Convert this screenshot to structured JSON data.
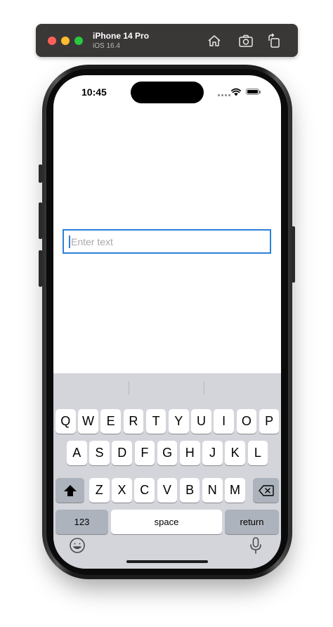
{
  "simulator": {
    "device_name": "iPhone 14 Pro",
    "os_version": "iOS 16.4",
    "icons": [
      "home-icon",
      "screenshot-icon",
      "rotate-icon"
    ]
  },
  "status_bar": {
    "time": "10:45"
  },
  "text_field": {
    "placeholder": "Enter text",
    "value": ""
  },
  "keyboard": {
    "row1": [
      "Q",
      "W",
      "E",
      "R",
      "T",
      "Y",
      "U",
      "I",
      "O",
      "P"
    ],
    "row2": [
      "A",
      "S",
      "D",
      "F",
      "G",
      "H",
      "J",
      "K",
      "L"
    ],
    "row3": [
      "Z",
      "X",
      "C",
      "V",
      "B",
      "N",
      "M"
    ],
    "numbers_label": "123",
    "space_label": "space",
    "return_label": "return"
  },
  "colors": {
    "accent": "#2d7fd9",
    "keyboard_bg": "#d3d5db",
    "function_key": "#adb3bc"
  }
}
